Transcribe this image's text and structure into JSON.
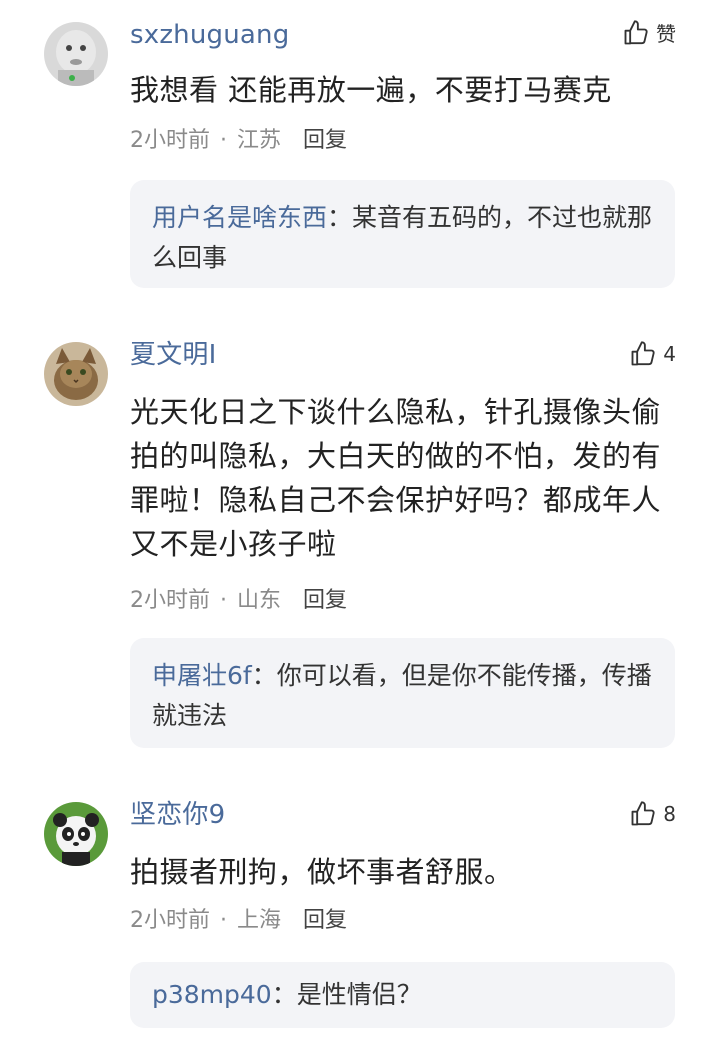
{
  "comments": [
    {
      "username": "sxzhuguang",
      "likes": "赞",
      "text": "我想看 还能再放一遍，不要打马赛克",
      "time": "2小时前",
      "location": "江苏",
      "reply_label": "回复",
      "reply": {
        "name": "用户名是啥东西",
        "sep": "：",
        "text": "某音有五码的，不过也就那么回事"
      }
    },
    {
      "username": "夏文明I",
      "likes": "4",
      "text": "光天化日之下谈什么隐私，针孔摄像头偷拍的叫隐私，大白天的做的不怕，发的有罪啦！隐私自己不会保护好吗？都成年人又不是小孩子啦",
      "time": "2小时前",
      "location": "山东",
      "reply_label": "回复",
      "reply": {
        "name": "申屠壮6f",
        "sep": "：",
        "text": "你可以看，但是你不能传播，传播就违法"
      }
    },
    {
      "username": "坚恋你9",
      "likes": "8",
      "text": "拍摄者刑拘，做坏事者舒服。",
      "time": "2小时前",
      "location": "上海",
      "reply_label": "回复",
      "reply": {
        "name": "p38mp40",
        "sep": "：",
        "text": "是性情侣？"
      }
    }
  ],
  "icons": {
    "like": "thumbs-up-icon"
  },
  "colors": {
    "username": "#4a6a9a",
    "meta": "#8a8a8a",
    "reply_bg": "#f3f4f7"
  }
}
